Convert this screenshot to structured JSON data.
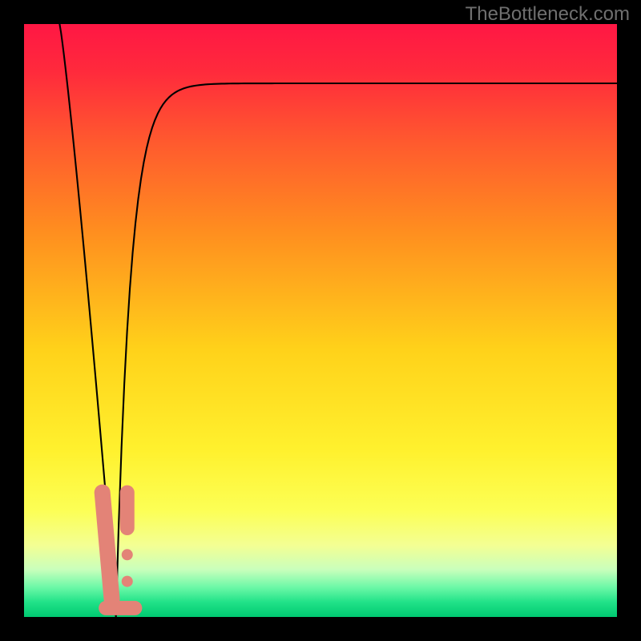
{
  "branding": {
    "watermark": "TheBottleneck.com"
  },
  "chart_data": {
    "type": "line",
    "title": "",
    "xlabel": "",
    "ylabel": "",
    "xlim": [
      0,
      100
    ],
    "ylim": [
      0,
      100
    ],
    "background": {
      "type": "vertical-gradient",
      "stops": [
        {
          "offset": 0.0,
          "color": "#ff1744"
        },
        {
          "offset": 0.08,
          "color": "#ff2a3c"
        },
        {
          "offset": 0.2,
          "color": "#ff5a2e"
        },
        {
          "offset": 0.35,
          "color": "#ff8e1f"
        },
        {
          "offset": 0.55,
          "color": "#ffd21a"
        },
        {
          "offset": 0.72,
          "color": "#fff12e"
        },
        {
          "offset": 0.82,
          "color": "#fcff55"
        },
        {
          "offset": 0.88,
          "color": "#f3ff94"
        },
        {
          "offset": 0.92,
          "color": "#c9ffbc"
        },
        {
          "offset": 0.95,
          "color": "#6cf8a7"
        },
        {
          "offset": 0.975,
          "color": "#21e288"
        },
        {
          "offset": 1.0,
          "color": "#00c971"
        }
      ]
    },
    "curve": {
      "stroke": "#000000",
      "stroke_width": 2.1,
      "notch_x": 15.5,
      "left_start_x": 6.0,
      "left_start_y": 100,
      "right_end_x": 100,
      "right_end_y": 90,
      "control": {
        "k_rise": 0.055,
        "asymptote": 90
      }
    },
    "markers": {
      "fill": "#e38377",
      "stroke": "#e38377",
      "groups": [
        {
          "shape": "capsule",
          "x1": 13.2,
          "y1": 21.0,
          "x2": 14.8,
          "y2": 3.0,
          "radius": 10
        },
        {
          "shape": "capsule",
          "x1": 17.4,
          "y1": 21.0,
          "x2": 17.4,
          "y2": 15.0,
          "radius": 9
        },
        {
          "shape": "circle",
          "cx": 17.4,
          "cy": 10.5,
          "r": 7
        },
        {
          "shape": "circle",
          "cx": 17.4,
          "cy": 6.0,
          "r": 7
        },
        {
          "shape": "capsule",
          "x1": 13.8,
          "y1": 1.5,
          "x2": 18.7,
          "y2": 1.5,
          "radius": 9
        }
      ]
    }
  }
}
